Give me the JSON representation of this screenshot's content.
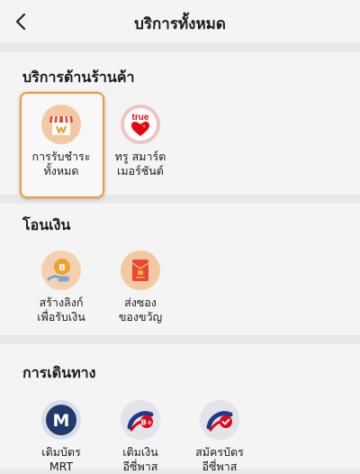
{
  "header": {
    "title": "บริการทั้งหมด"
  },
  "sections": [
    {
      "title": "บริการด้านร้านค้า",
      "items": [
        {
          "label1": "การรับชำระ",
          "label2": "ทั้งหมด",
          "icon": "shop-awning-icon",
          "selected": true
        },
        {
          "label1": "ทรู สมาร์ต",
          "label2": "เมอร์ชันต์",
          "icon": "true-merchant-icon",
          "selected": false
        }
      ]
    },
    {
      "title": "โอนเงิน",
      "items": [
        {
          "label1": "สร้างลิงก์",
          "label2": "เพื่อรับเงิน",
          "icon": "coin-hand-icon"
        },
        {
          "label1": "ส่งซอง",
          "label2": "ของขวัญ",
          "icon": "gift-envelope-icon"
        }
      ]
    },
    {
      "title": "การเดินทาง",
      "items": [
        {
          "label1": "เติมบัตร",
          "label2": "MRT",
          "icon": "mrt-logo-icon"
        },
        {
          "label1": "เติมเงิน",
          "label2": "อีซี่พาส",
          "icon": "easy-pass-topup-icon"
        },
        {
          "label1": "สมัครบัตร",
          "label2": "อีซี่พาส",
          "icon": "easy-pass-apply-icon"
        }
      ]
    }
  ],
  "colors": {
    "accent": "#f19a3a",
    "background": "#e8e8e8",
    "card": "#f4f4f4"
  }
}
